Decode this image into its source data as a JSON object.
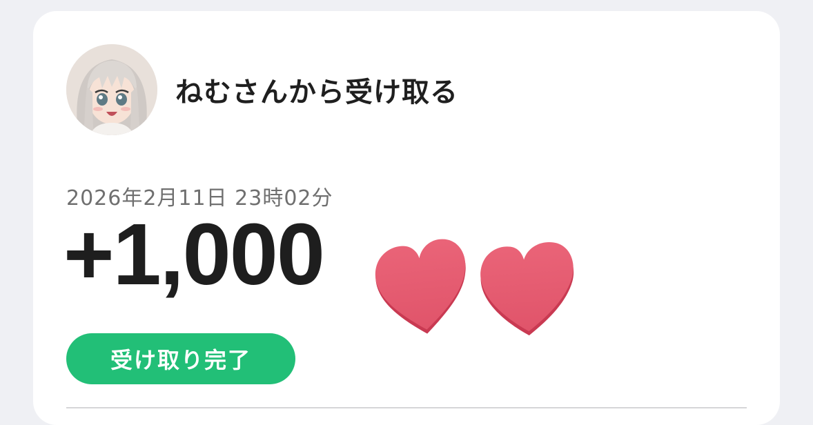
{
  "header": {
    "title": "ねむさんから受け取る",
    "avatar_icon": "anime-girl-avatar"
  },
  "transaction": {
    "timestamp": "2026年2月11日 23時02分",
    "amount": "+1,000",
    "currency_icon": "heart-icon",
    "status": "受け取り完了"
  },
  "colors": {
    "background": "#eff0f4",
    "card": "#ffffff",
    "status_green": "#22bf77",
    "heart_red": "#e85b70"
  }
}
